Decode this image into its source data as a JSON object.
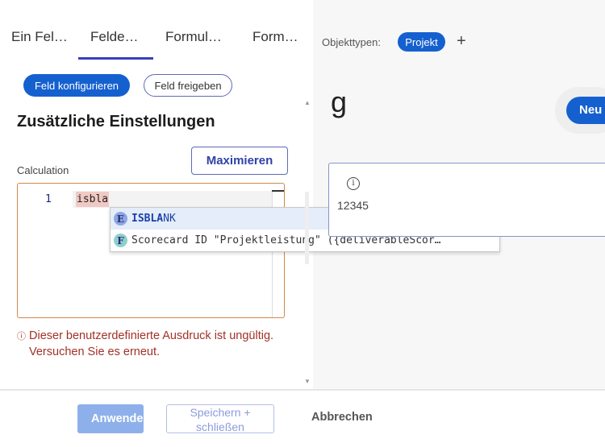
{
  "tabs": [
    "Ein Fel…",
    "Felde…",
    "Formul…",
    "Form…"
  ],
  "buttons": {
    "configure": "Feld konfigurieren",
    "share": "Feld freigeben",
    "maximize": "Maximieren"
  },
  "section_title": "Zusätzliche Einstellungen",
  "calculation": {
    "label": "Calculation",
    "line_number": "1",
    "code": "isbla"
  },
  "autocomplete": [
    {
      "kind": "E",
      "label": "ISBLANK",
      "match": "ISBLA",
      "rest": "NK"
    },
    {
      "kind": "F",
      "label": "Scorecard ID \"Projektleistung\" ({deliverableScor…"
    }
  ],
  "error": {
    "icon": "ⓘ",
    "text": "Dieser benutzerdefinierte Ausdruck ist ungültig. Versuchen Sie es erneut."
  },
  "footer": {
    "apply": "Anwenden",
    "save": "Speichern + schließen",
    "cancel": "Abbrechen"
  },
  "right": {
    "object_types_label": "Objekttypen:",
    "object_type": "Projekt",
    "add": "+",
    "title": "g",
    "new_button": "Neu",
    "field_value": "12345"
  },
  "colors": {
    "primary": "#1560cf",
    "error": "#a23127",
    "editor_border": "#d0884a"
  }
}
